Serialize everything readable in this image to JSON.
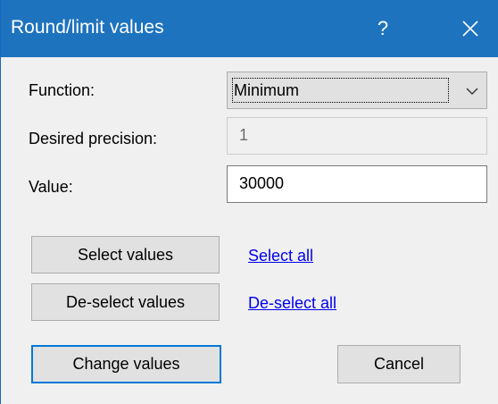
{
  "window": {
    "title": "Round/limit values",
    "help_label": "?",
    "close_icon": "close-icon"
  },
  "form": {
    "function_label": "Function:",
    "function_value": "Minimum",
    "precision_label": "Desired precision:",
    "precision_value": "1",
    "value_label": "Value:",
    "value_value": "30000"
  },
  "actions": {
    "select_values": "Select values",
    "select_all": "Select all",
    "deselect_values": "De-select values",
    "deselect_all": "De-select all",
    "change_values": "Change values",
    "cancel": "Cancel"
  },
  "colors": {
    "titlebar": "#1e73be",
    "link": "#0000ee",
    "focus_border": "#0078d7"
  }
}
